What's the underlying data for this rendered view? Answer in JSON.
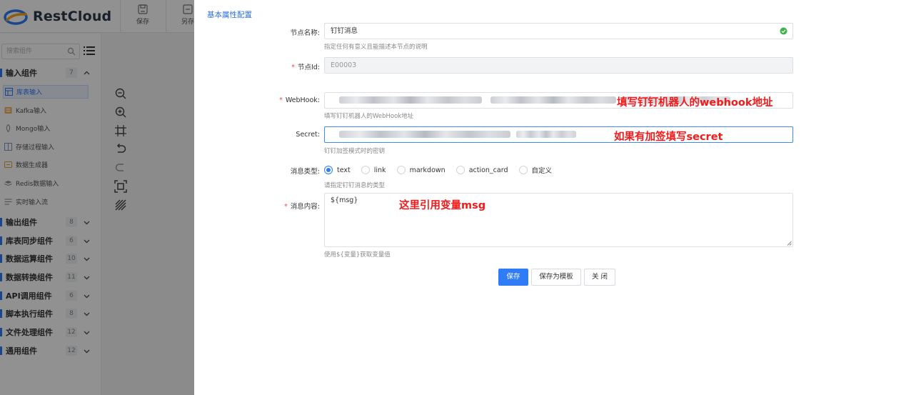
{
  "app": {
    "brand": "RestCloud",
    "brand_color": "#2f7cf6"
  },
  "toolbar": {
    "save_label": "保存",
    "save_as_label": "另存"
  },
  "sidebar": {
    "search_placeholder": "搜索组件",
    "groups": [
      {
        "name": "输入组件",
        "count": "7",
        "expanded": true
      },
      {
        "name": "输出组件",
        "count": "8"
      },
      {
        "name": "库表同步组件",
        "count": "6"
      },
      {
        "name": "数据运算组件",
        "count": "10"
      },
      {
        "name": "数据转换组件",
        "count": "11"
      },
      {
        "name": "API调用组件",
        "count": "6"
      },
      {
        "name": "脚本执行组件",
        "count": "8"
      },
      {
        "name": "文件处理组件",
        "count": "12"
      },
      {
        "name": "通用组件",
        "count": "12"
      }
    ],
    "items": [
      {
        "label": "库表输入",
        "icon": "table-icon",
        "active": true
      },
      {
        "label": "Kafka输入",
        "icon": "kafka-icon"
      },
      {
        "label": "Mongo输入",
        "icon": "mongo-icon"
      },
      {
        "label": "存储过程输入",
        "icon": "procedure-icon"
      },
      {
        "label": "数据生成器",
        "icon": "generator-icon"
      },
      {
        "label": "Redis数据输入",
        "icon": "redis-icon"
      },
      {
        "label": "实时输入流",
        "icon": "stream-icon"
      }
    ],
    "canvas_tools": [
      "zoom-out-icon",
      "zoom-in-icon",
      "fit-view-icon",
      "undo-icon",
      "redo-icon",
      "fullscreen-icon",
      "grid-icon"
    ]
  },
  "form": {
    "section_title": "基本属性配置",
    "node_name": {
      "label": "节点名称:",
      "value": "钉钉消息",
      "hint": "指定任何有意义且能描述本节点的说明"
    },
    "node_id": {
      "label": "节点Id:",
      "value": "E00003"
    },
    "webhook": {
      "label": "WebHook:",
      "hint": "填写钉钉机器人的WebHook地址",
      "annotation": "填写钉钉机器人的webhook地址"
    },
    "secret": {
      "label": "Secret:",
      "hint": "钉钉加签模式时的密钥",
      "annotation": "如果有加签填写secret"
    },
    "msg_type": {
      "label": "消息类型:",
      "options": [
        "text",
        "link",
        "markdown",
        "action_card",
        "自定义"
      ],
      "selected": "text",
      "hint": "请指定钉钉消息的类型"
    },
    "msg_content": {
      "label": "消息内容:",
      "value": "${msg}",
      "hint": "使用${变量}获取变量值",
      "annotation": "这里引用变量msg"
    },
    "buttons": {
      "save": "保存",
      "save_template": "保存为模板",
      "close": "关 闭"
    }
  }
}
